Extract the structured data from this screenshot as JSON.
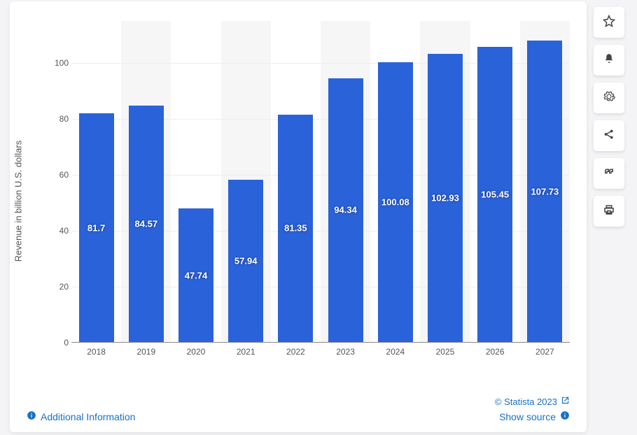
{
  "chart_data": {
    "type": "bar",
    "categories": [
      "2018",
      "2019",
      "2020",
      "2021",
      "2022",
      "2023",
      "2024",
      "2025",
      "2026",
      "2027"
    ],
    "values": [
      81.7,
      84.57,
      47.74,
      57.94,
      81.35,
      94.34,
      100.08,
      102.93,
      105.45,
      107.73
    ],
    "ylabel": "Revenue in billion U.S. dollars",
    "y_ticks": [
      0,
      20,
      40,
      60,
      80,
      100
    ],
    "ylim": [
      0,
      115
    ],
    "title": "",
    "xlabel": ""
  },
  "footer": {
    "additional_info": "Additional Information",
    "copyright": "© Statista 2023",
    "show_source": "Show source"
  },
  "side_icons": [
    "star-icon",
    "bell-icon",
    "gear-icon",
    "share-icon",
    "quote-icon",
    "print-icon"
  ]
}
